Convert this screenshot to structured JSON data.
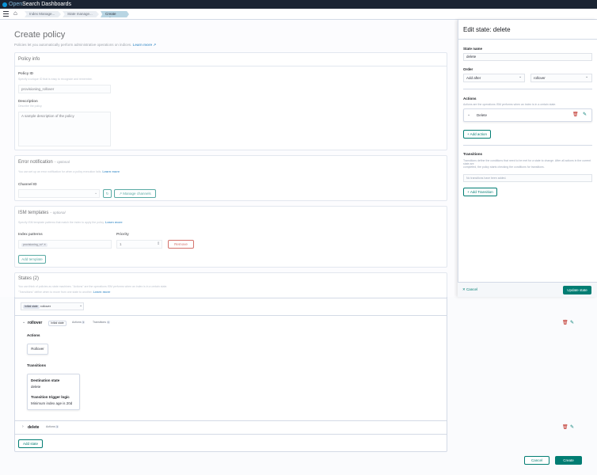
{
  "header": {
    "brand_1": "Open",
    "brand_2": "Search Dashboards"
  },
  "breadcrumbs": [
    "Index Manage...",
    "State manage...",
    "Create policy"
  ],
  "page": {
    "title": "Create policy",
    "subtitle": "Policies let you automatically perform administrative operations on indices.",
    "learn_more": "Learn more"
  },
  "policy_info": {
    "title": "Policy info",
    "policy_id_label": "Policy ID",
    "policy_id_help": "Specify a unique ID that is easy to recognize and remember.",
    "policy_id_value": "provisioning_rollover",
    "description_label": "Description",
    "description_help": "Describe the policy.",
    "description_value": "A sample description of the policy"
  },
  "error_notification": {
    "title": "Error notification",
    "optional": "– optional",
    "help": "You can set up an error notification for when a policy execution fails.",
    "learn_more": "Learn more",
    "channel_label": "Channel ID",
    "manage_channels": "Manage channels"
  },
  "ism_templates": {
    "title": "ISM templates",
    "optional": "– optional",
    "help": "Specify ISM template patterns that match the index to apply the policy.",
    "learn_more": "Learn more",
    "index_patterns_label": "Index patterns",
    "index_pattern_value": "provisioning_ro*",
    "priority_label": "Priority",
    "priority_value": "1",
    "remove": "Remove",
    "add_template": "Add template"
  },
  "states": {
    "title": "States (2)",
    "help_1": "You can think of policies as state machines. \"Actions\" are the operations ISM performs when an index is in a certain state.",
    "help_2": "\"Transitions\" define when to move from one state to another.",
    "learn_more": "Learn more",
    "initial_state_prefix": "Initial state",
    "initial_state_value": "rollover",
    "items": [
      {
        "name": "rollover",
        "badge": "Initial state",
        "actions_label": "Actions",
        "actions_count": "1",
        "transitions_label": "Transitions",
        "transitions_count": "1"
      },
      {
        "name": "delete",
        "actions_label": "Actions",
        "actions_count": "1"
      }
    ],
    "detail": {
      "actions_heading": "Actions",
      "action_card": "Rollover",
      "transitions_heading": "Transitions",
      "dest_label": "Destination state",
      "dest_value": "delete",
      "trigger_label": "Transition trigger logic",
      "trigger_value": "Minimum index age is 20d"
    },
    "add_state": "Add state"
  },
  "footer": {
    "cancel": "Cancel",
    "create": "Create"
  },
  "flyout": {
    "title": "Edit state: delete",
    "state_name_label": "State name",
    "state_name_value": "delete",
    "order_label": "Order",
    "order_value": "Add after",
    "order_target": "rollover",
    "actions_label": "Actions",
    "actions_help": "Actions are the operations ISM performs when an index is in a certain state.",
    "action_item": "Delete",
    "add_action": "+ Add action",
    "transitions_label": "Transitions",
    "transitions_help_1": "Transitions define the conditions that need to be met for a state to change. After all actions in the current state are",
    "transitions_help_2": "completed, the policy starts checking the conditions for transitions.",
    "transitions_placeholder": "No transitions have been added.",
    "add_transition": "+ Add Transition",
    "cancel": "Cancel",
    "update": "Update state"
  },
  "colors": {
    "primary": "#017d73",
    "danger": "#bd271e",
    "link": "#006bb8",
    "header": "#1b2433"
  }
}
